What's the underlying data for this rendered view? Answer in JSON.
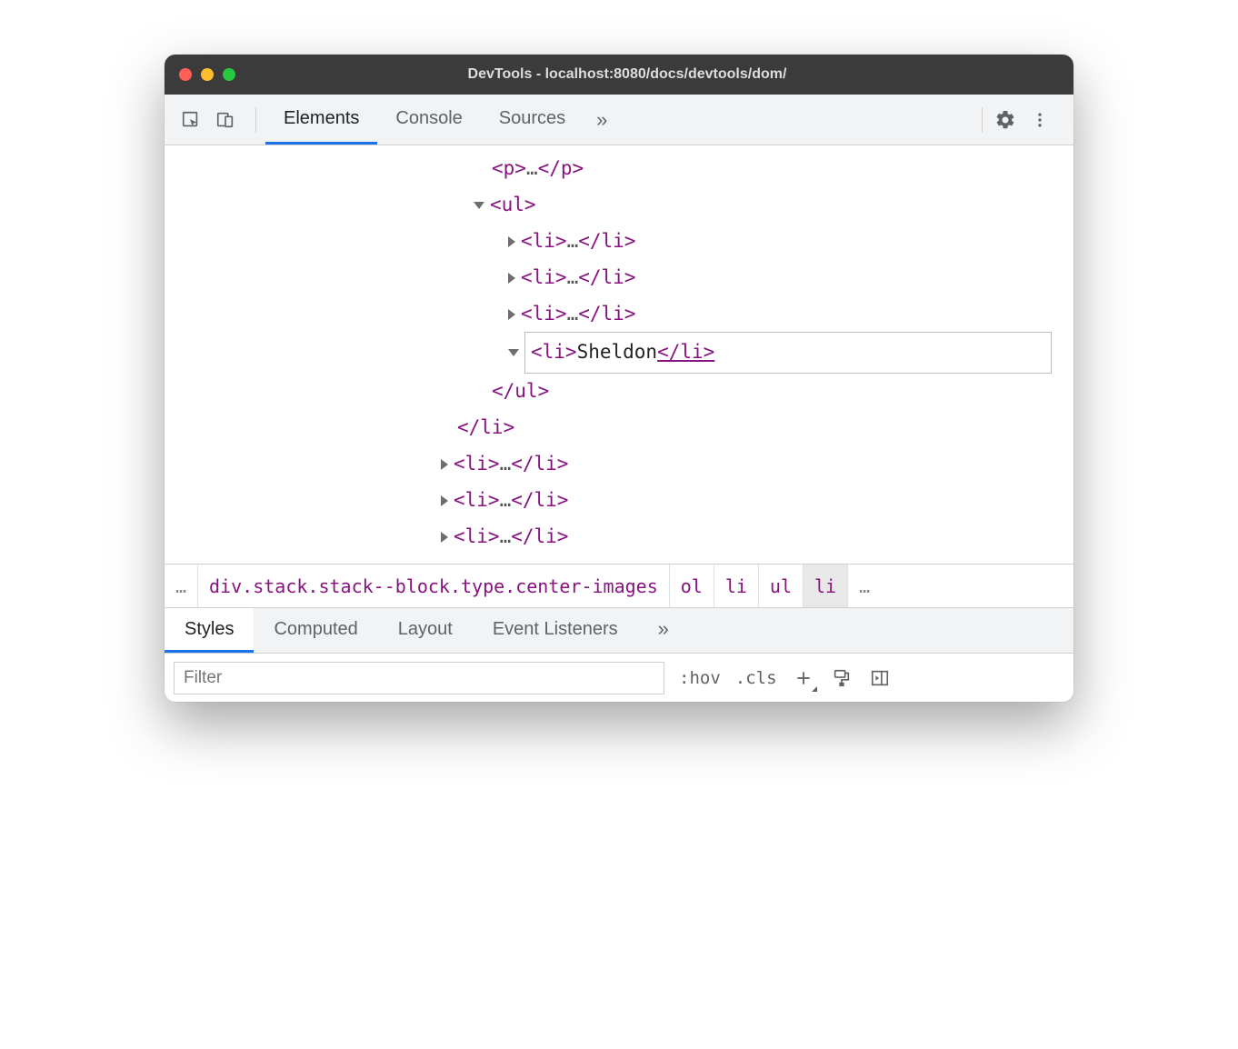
{
  "window": {
    "title": "DevTools - localhost:8080/docs/devtools/dom/"
  },
  "toolbar": {
    "tabs": {
      "elements": "Elements",
      "console": "Console",
      "sources": "Sources"
    }
  },
  "dom": {
    "p_open": "<p>",
    "p_ell": "…",
    "p_close": "</p>",
    "ul_open": "<ul>",
    "li_c1_open": "<li>",
    "li_c1_ell": "…",
    "li_c1_close": "</li>",
    "li_c2_open": "<li>",
    "li_c2_ell": "…",
    "li_c2_close": "</li>",
    "li_c3_open": "<li>",
    "li_c3_ell": "…",
    "li_c3_close": "</li>",
    "edit_open": "<li>",
    "edit_text": "Sheldon",
    "edit_close": "</li>",
    "ul_close": "</ul>",
    "li_outer_close": "</li>",
    "li_o1_open": "<li>",
    "li_o1_ell": "…",
    "li_o1_close": "</li>",
    "li_o2_open": "<li>",
    "li_o2_ell": "…",
    "li_o2_close": "</li>",
    "li_o3_open": "<li>",
    "li_o3_ell": "…",
    "li_o3_close": "</li>"
  },
  "breadcrumb": {
    "ell": "…",
    "sel": "div.stack.stack--block.type.center-images",
    "ol": "ol",
    "li1": "li",
    "ul": "ul",
    "li2": "li",
    "ell2": "…"
  },
  "styles_tabs": {
    "styles": "Styles",
    "computed": "Computed",
    "layout": "Layout",
    "listeners": "Event Listeners"
  },
  "styles_toolbar": {
    "filter_placeholder": "Filter",
    "hov": ":hov",
    "cls": ".cls"
  }
}
